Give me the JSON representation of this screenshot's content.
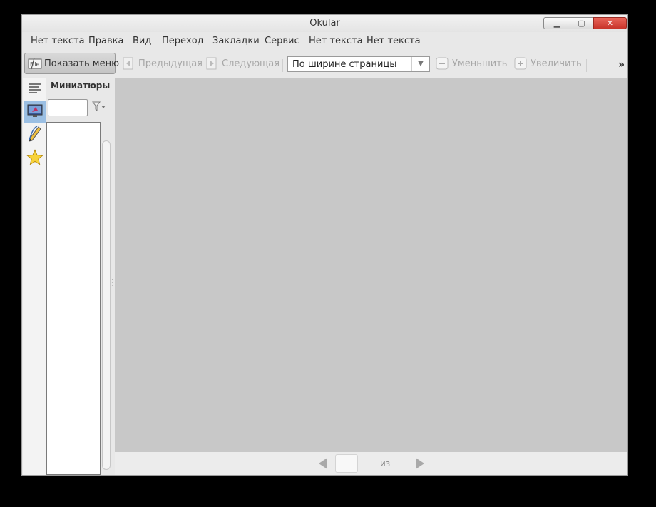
{
  "window": {
    "title": "Okular",
    "controls": {
      "minimize": "▁",
      "maximize": "▢",
      "close": "✕"
    }
  },
  "menubar": {
    "items": [
      "Нет текста",
      "Правка",
      "Вид",
      "Переход",
      "Закладки",
      "Сервис",
      "Нет текста",
      "Нет текста"
    ]
  },
  "toolbar": {
    "show_menu": "Показать меню",
    "previous": "Предыдущая",
    "next": "Следующая",
    "zoom_mode": "По ширине страницы",
    "zoom_out": "Уменьшить",
    "zoom_in": "Увеличить",
    "overflow": "»"
  },
  "sidebar": {
    "icons": [
      "contents-icon",
      "thumbnails-icon",
      "annotations-icon",
      "bookmarks-icon"
    ],
    "selected_index": 1
  },
  "panel": {
    "title": "Миниатюры",
    "filter_value": ""
  },
  "bottombar": {
    "page_value": "",
    "of_label": "из"
  },
  "colors": {
    "view_background": "#c8c8c8",
    "selected_icon_bg": "#9bbfe3",
    "close_button": "#d5483c"
  }
}
